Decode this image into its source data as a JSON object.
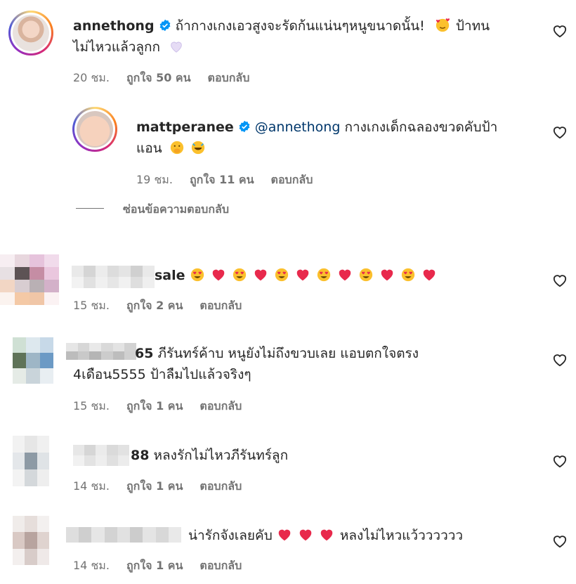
{
  "comments": [
    {
      "username": "annethong",
      "text_line1": "ถ้ากางเกงเอวสูงจะรัดก้นแน่นๆหนูขนาดนั้น!",
      "text_line2": "ป้าทน",
      "text_line3": "ไม่ไหวแล้วลูกก",
      "time": "20 ชม.",
      "likes": "ถูกใจ 50 คน",
      "reply": "ตอบกลับ"
    },
    {
      "username": "mattperanee",
      "mention": "@annethong",
      "text_line1": "กางเกงเด็กฉลองขวดคับป้า",
      "text_line2": "แอน",
      "time": "19 ชม.",
      "likes": "ถูกใจ 11 คน",
      "reply": "ตอบกลับ"
    },
    {
      "username_visible": "sale",
      "time": "15 ชม.",
      "likes": "ถูกใจ 2 คน",
      "reply": "ตอบกลับ"
    },
    {
      "username_visible": "65",
      "text_line1": "ภีรันทร์ค้าบ หนูยังไม่ถึงขวบเลย แอบตกใจตรง",
      "text_line2": "4เดือน5555 ป้าลืมไปแล้วจริงๆ",
      "time": "15 ชม.",
      "likes": "ถูกใจ 1 คน",
      "reply": "ตอบกลับ"
    },
    {
      "username_visible": "88",
      "text_line1": "หลงรักไม่ไหวภีรันทร์ลูก",
      "time": "14 ชม.",
      "likes": "ถูกใจ 1 คน",
      "reply": "ตอบกลับ"
    },
    {
      "text_line1": "น่ารักจังเลยคับ",
      "text_line2": "หลงไม่ไหวแว้วววววว",
      "time": "14 ชม.",
      "likes": "ถูกใจ 1 คน",
      "reply": "ตอบกลับ"
    }
  ],
  "hide_replies": "ซ่อนข้อความตอบกลับ",
  "colors": {
    "verified": "#0095f6",
    "heart": "#e8294c",
    "meta": "#737373",
    "mention": "#00376b"
  }
}
